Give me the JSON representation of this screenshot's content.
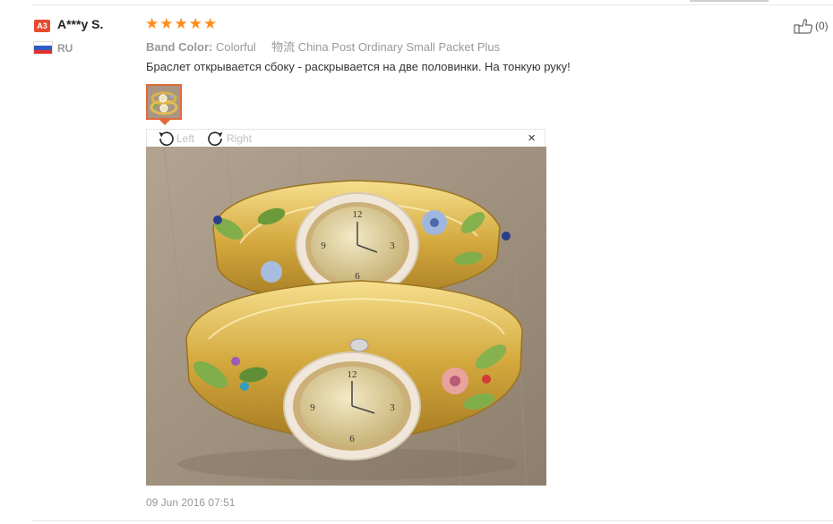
{
  "reviewer": {
    "badge": "A3",
    "name": "A***y S.",
    "country": "RU",
    "flag_colors": [
      "#ffffff",
      "#2f5cc4",
      "#e03131"
    ]
  },
  "rating": {
    "value": 5,
    "max": 5,
    "star_glyph": "★",
    "color": "#ff8c1a"
  },
  "attributes": [
    {
      "key": "Band Color:",
      "value": "Colorful"
    },
    {
      "key": "物流",
      "value": "China Post Ordinary Small Packet Plus"
    }
  ],
  "review_text": "Браслет открывается сбоку - раскрывается на две половинки. На тонкую руку!",
  "viewer": {
    "rotate_left_label": "Left",
    "rotate_right_label": "Right",
    "close_glyph": "×"
  },
  "date": "09 Jun 2016 07:51",
  "helpful": {
    "count_label": "(0)"
  },
  "icons": [
    "rotate-left-icon",
    "rotate-right-icon",
    "close-icon",
    "thumbs-up-icon",
    "star-icon",
    "flag-icon"
  ]
}
